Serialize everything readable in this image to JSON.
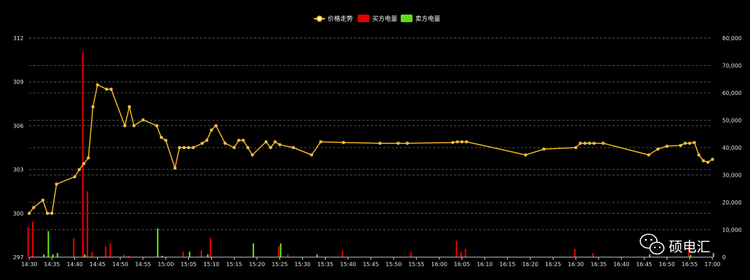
{
  "legend": {
    "price": "价格走势",
    "buy": "买方电量",
    "sell": "卖方电量"
  },
  "watermark": {
    "text": "硕电汇",
    "icon": "wechat-icon"
  },
  "colors": {
    "price": "#f5b822",
    "buy": "#e00000",
    "sell": "#5fdc16",
    "grid": "#6e6e6e",
    "axis": "#cccccc"
  },
  "chart_data": {
    "type": "line",
    "title": "",
    "x_ticks": [
      "14:30",
      "14:35",
      "14:40",
      "14:45",
      "14:50",
      "14:55",
      "15:00",
      "15:05",
      "15:10",
      "15:15",
      "15:20",
      "15:25",
      "15:30",
      "15:35",
      "15:40",
      "15:45",
      "15:50",
      "15:55",
      "16:00",
      "16:05",
      "16:10",
      "16:15",
      "16:20",
      "16:25",
      "16:30",
      "16:35",
      "16:40",
      "16:45",
      "16:50",
      "16:55",
      "17:00"
    ],
    "x_range_minutes": [
      0,
      150
    ],
    "y_left": {
      "ticks": [
        "297",
        "300",
        "303",
        "306",
        "309",
        "312"
      ],
      "range": [
        297,
        312
      ]
    },
    "y_right": {
      "ticks": [
        "0",
        "10,000",
        "20,000",
        "30,000",
        "40,000",
        "50,000",
        "60,000",
        "70,000",
        "80,000"
      ],
      "range": [
        0,
        80000
      ]
    },
    "grid": true,
    "legend_position": "top-center",
    "series": [
      {
        "name": "价格走势",
        "kind": "line",
        "axis": "left",
        "points": [
          [
            0,
            300
          ],
          [
            1,
            300.4
          ],
          [
            3,
            300.9
          ],
          [
            4,
            300
          ],
          [
            5,
            300
          ],
          [
            6,
            302
          ],
          [
            10,
            302.5
          ],
          [
            11,
            303
          ],
          [
            12,
            303.4
          ],
          [
            13,
            303.8
          ],
          [
            14,
            307.3
          ],
          [
            15,
            308.8
          ],
          [
            17,
            308.5
          ],
          [
            18,
            308.5
          ],
          [
            21,
            306
          ],
          [
            22,
            307.3
          ],
          [
            23,
            306
          ],
          [
            25,
            306.4
          ],
          [
            28,
            306
          ],
          [
            29,
            305.2
          ],
          [
            30,
            305
          ],
          [
            32,
            303.1
          ],
          [
            33,
            304.5
          ],
          [
            34,
            304.5
          ],
          [
            35,
            304.5
          ],
          [
            36,
            304.5
          ],
          [
            38,
            304.8
          ],
          [
            39,
            305
          ],
          [
            40,
            305.7
          ],
          [
            41,
            306
          ],
          [
            43,
            304.8
          ],
          [
            45,
            304.5
          ],
          [
            46,
            305
          ],
          [
            47,
            305
          ],
          [
            48,
            304.5
          ],
          [
            49,
            304
          ],
          [
            52,
            304.9
          ],
          [
            53,
            304.5
          ],
          [
            54,
            304.9
          ],
          [
            55,
            304.7
          ],
          [
            58,
            304.5
          ],
          [
            62,
            304
          ],
          [
            64,
            304.9
          ],
          [
            69,
            304.85
          ],
          [
            77,
            304.8
          ],
          [
            81,
            304.8
          ],
          [
            83,
            304.8
          ],
          [
            93,
            304.85
          ],
          [
            94,
            304.9
          ],
          [
            95,
            304.9
          ],
          [
            96,
            304.9
          ],
          [
            109,
            304
          ],
          [
            113,
            304.4
          ],
          [
            120,
            304.5
          ],
          [
            121,
            304.8
          ],
          [
            122,
            304.8
          ],
          [
            123,
            304.8
          ],
          [
            124,
            304.8
          ],
          [
            126,
            304.8
          ],
          [
            136,
            304
          ],
          [
            138,
            304.4
          ],
          [
            140,
            304.6
          ],
          [
            143,
            304.65
          ],
          [
            144,
            304.8
          ],
          [
            145,
            304.8
          ],
          [
            146,
            304.85
          ],
          [
            147,
            304
          ],
          [
            148,
            303.6
          ],
          [
            149,
            303.5
          ],
          [
            150,
            303.7
          ]
        ]
      },
      {
        "name": "买方电量",
        "kind": "bar",
        "axis": "right",
        "points": [
          [
            0,
            11000
          ],
          [
            1,
            13000
          ],
          [
            10,
            7000
          ],
          [
            12,
            75000
          ],
          [
            13,
            24000
          ],
          [
            14,
            2000
          ],
          [
            17,
            4000
          ],
          [
            18,
            5000
          ],
          [
            21,
            1000
          ],
          [
            22,
            500
          ],
          [
            34,
            2000
          ],
          [
            38,
            2500
          ],
          [
            40,
            7000
          ],
          [
            55,
            4000
          ],
          [
            57,
            1000
          ],
          [
            69,
            2500
          ],
          [
            84,
            2000
          ],
          [
            94,
            6000
          ],
          [
            95,
            2000
          ],
          [
            96,
            3000
          ],
          [
            120,
            3000
          ],
          [
            124,
            1500
          ],
          [
            145,
            4500
          ]
        ]
      },
      {
        "name": "卖方电量",
        "kind": "bar",
        "axis": "right",
        "points": [
          [
            3,
            1000
          ],
          [
            4,
            9500
          ],
          [
            5,
            1000
          ],
          [
            6,
            1500
          ],
          [
            12,
            1000
          ],
          [
            28,
            10500
          ],
          [
            29,
            500
          ],
          [
            35,
            2000
          ],
          [
            39,
            1000
          ],
          [
            49,
            5000
          ],
          [
            55,
            5000
          ],
          [
            63,
            1000
          ],
          [
            136,
            1000
          ],
          [
            145,
            800
          ],
          [
            150,
            1500
          ]
        ]
      }
    ]
  }
}
